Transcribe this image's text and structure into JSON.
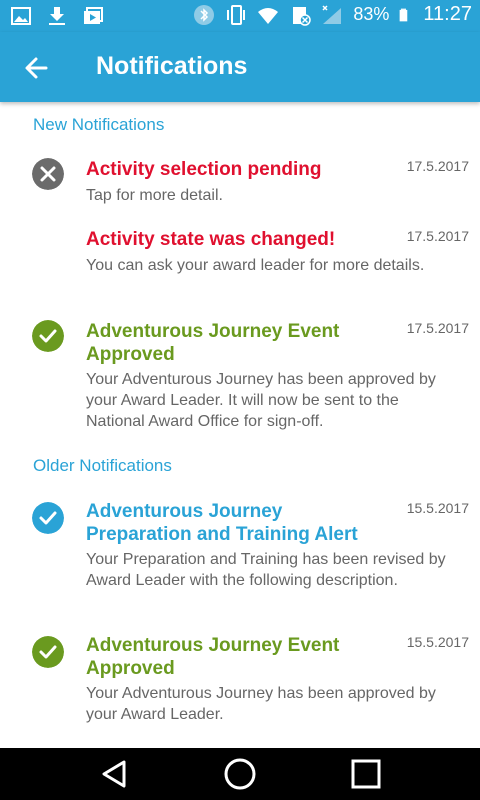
{
  "status_bar": {
    "battery": "83%",
    "time": "11:27",
    "icons": [
      "image-icon",
      "download-icon",
      "media-icon",
      "bluetooth-icon",
      "vibrate-icon",
      "wifi-icon",
      "sim-icon",
      "signal-icon",
      "battery-icon"
    ]
  },
  "app_bar": {
    "title": "Notifications",
    "back_icon": "arrow-left-icon"
  },
  "sections": {
    "new": {
      "label": "New Notifications"
    },
    "older": {
      "label": "Older Notifications"
    }
  },
  "notifications": [
    {
      "title": "Activity selection pending",
      "date": "17.5.2017",
      "description": "Tap for more detail.",
      "status": "rejected",
      "icon": "x-circle-icon",
      "title_color": "#e0102f"
    },
    {
      "title": "Activity state was changed!",
      "date": "17.5.2017",
      "description": "You can ask your award leader for more details.",
      "status": "changed",
      "icon": "",
      "title_color": "#e0102f"
    },
    {
      "title": "Adventurous Journey Event Approved",
      "date": "17.5.2017",
      "description": "Your Adventurous Journey has been approved by your Award Leader. It will now be sent to the National Award Office for sign-off.",
      "status": "approved",
      "icon": "check-circle-icon",
      "title_color": "#6a9a1f"
    },
    {
      "title": "Adventurous Journey Preparation and Training Alert",
      "date": "15.5.2017",
      "description": "Your Preparation and Training has been revised by Award Leader with the following description.",
      "status": "info",
      "icon": "check-circle-icon",
      "title_color": "#2aa3d6"
    },
    {
      "title": "Adventurous Journey Event Approved",
      "date": "15.5.2017",
      "description": "Your Adventurous Journey has been approved by your Award Leader.",
      "status": "approved",
      "icon": "check-circle-icon",
      "title_color": "#6a9a1f"
    }
  ],
  "nav_bar": {
    "back_icon": "nav-back-icon",
    "home_icon": "nav-home-icon",
    "recents_icon": "nav-recents-icon"
  },
  "colors": {
    "primary": "#2aa3d6",
    "danger": "#e0102f",
    "success": "#6a9a1f",
    "muted": "#666666"
  }
}
